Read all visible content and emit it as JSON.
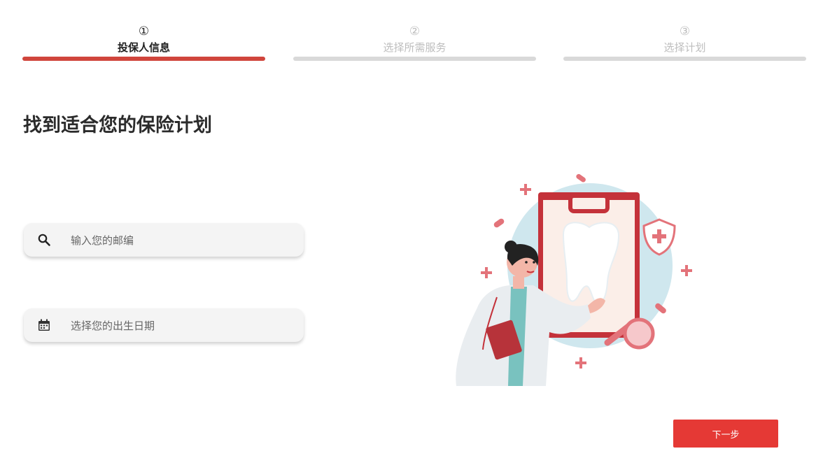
{
  "steps": [
    {
      "number": "①",
      "label": "投保人信息",
      "state": "active"
    },
    {
      "number": "②",
      "label": "选择所需服务",
      "state": "inactive"
    },
    {
      "number": "③",
      "label": "选择计划",
      "state": "inactive"
    }
  ],
  "colors": {
    "accent": "#d0453c",
    "button": "#e53935",
    "inactive_bar": "#d9d9d9"
  },
  "main": {
    "title": "找到适合您的保险计划",
    "zip_field": {
      "placeholder": "输入您的邮编",
      "icon": "search-icon"
    },
    "dob_field": {
      "placeholder": "选择您的出生日期",
      "icon": "calendar-icon"
    }
  },
  "footer": {
    "next_label": "下一步"
  }
}
